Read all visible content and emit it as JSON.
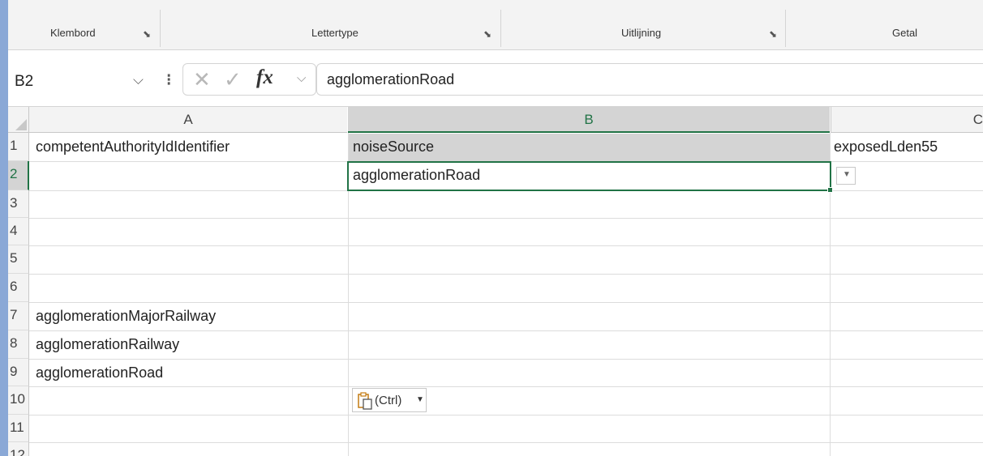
{
  "ribbon": {
    "groups": [
      {
        "label": "Klembord"
      },
      {
        "label": "Lettertype"
      },
      {
        "label": "Uitlijning"
      },
      {
        "label": "Getal"
      }
    ]
  },
  "formula_bar": {
    "name_box": "B2",
    "formula": "agglomerationRoad",
    "fx_label": "fx"
  },
  "grid": {
    "columns": [
      "A",
      "B",
      "C"
    ],
    "rows": [
      "1",
      "2",
      "3",
      "4",
      "5",
      "6",
      "7",
      "8",
      "9",
      "10",
      "11",
      "12"
    ],
    "cells": {
      "A1": "competentAuthorityIdIdentifier",
      "B1": "noiseSource",
      "C1": "exposedLden55",
      "B2": "agglomerationRoad",
      "A7": "agglomerationMajorRailway",
      "A8": "agglomerationRailway",
      "A9": "agglomerationRoad"
    },
    "active_cell": "B2"
  },
  "paste_options": {
    "label": "(Ctrl)"
  }
}
